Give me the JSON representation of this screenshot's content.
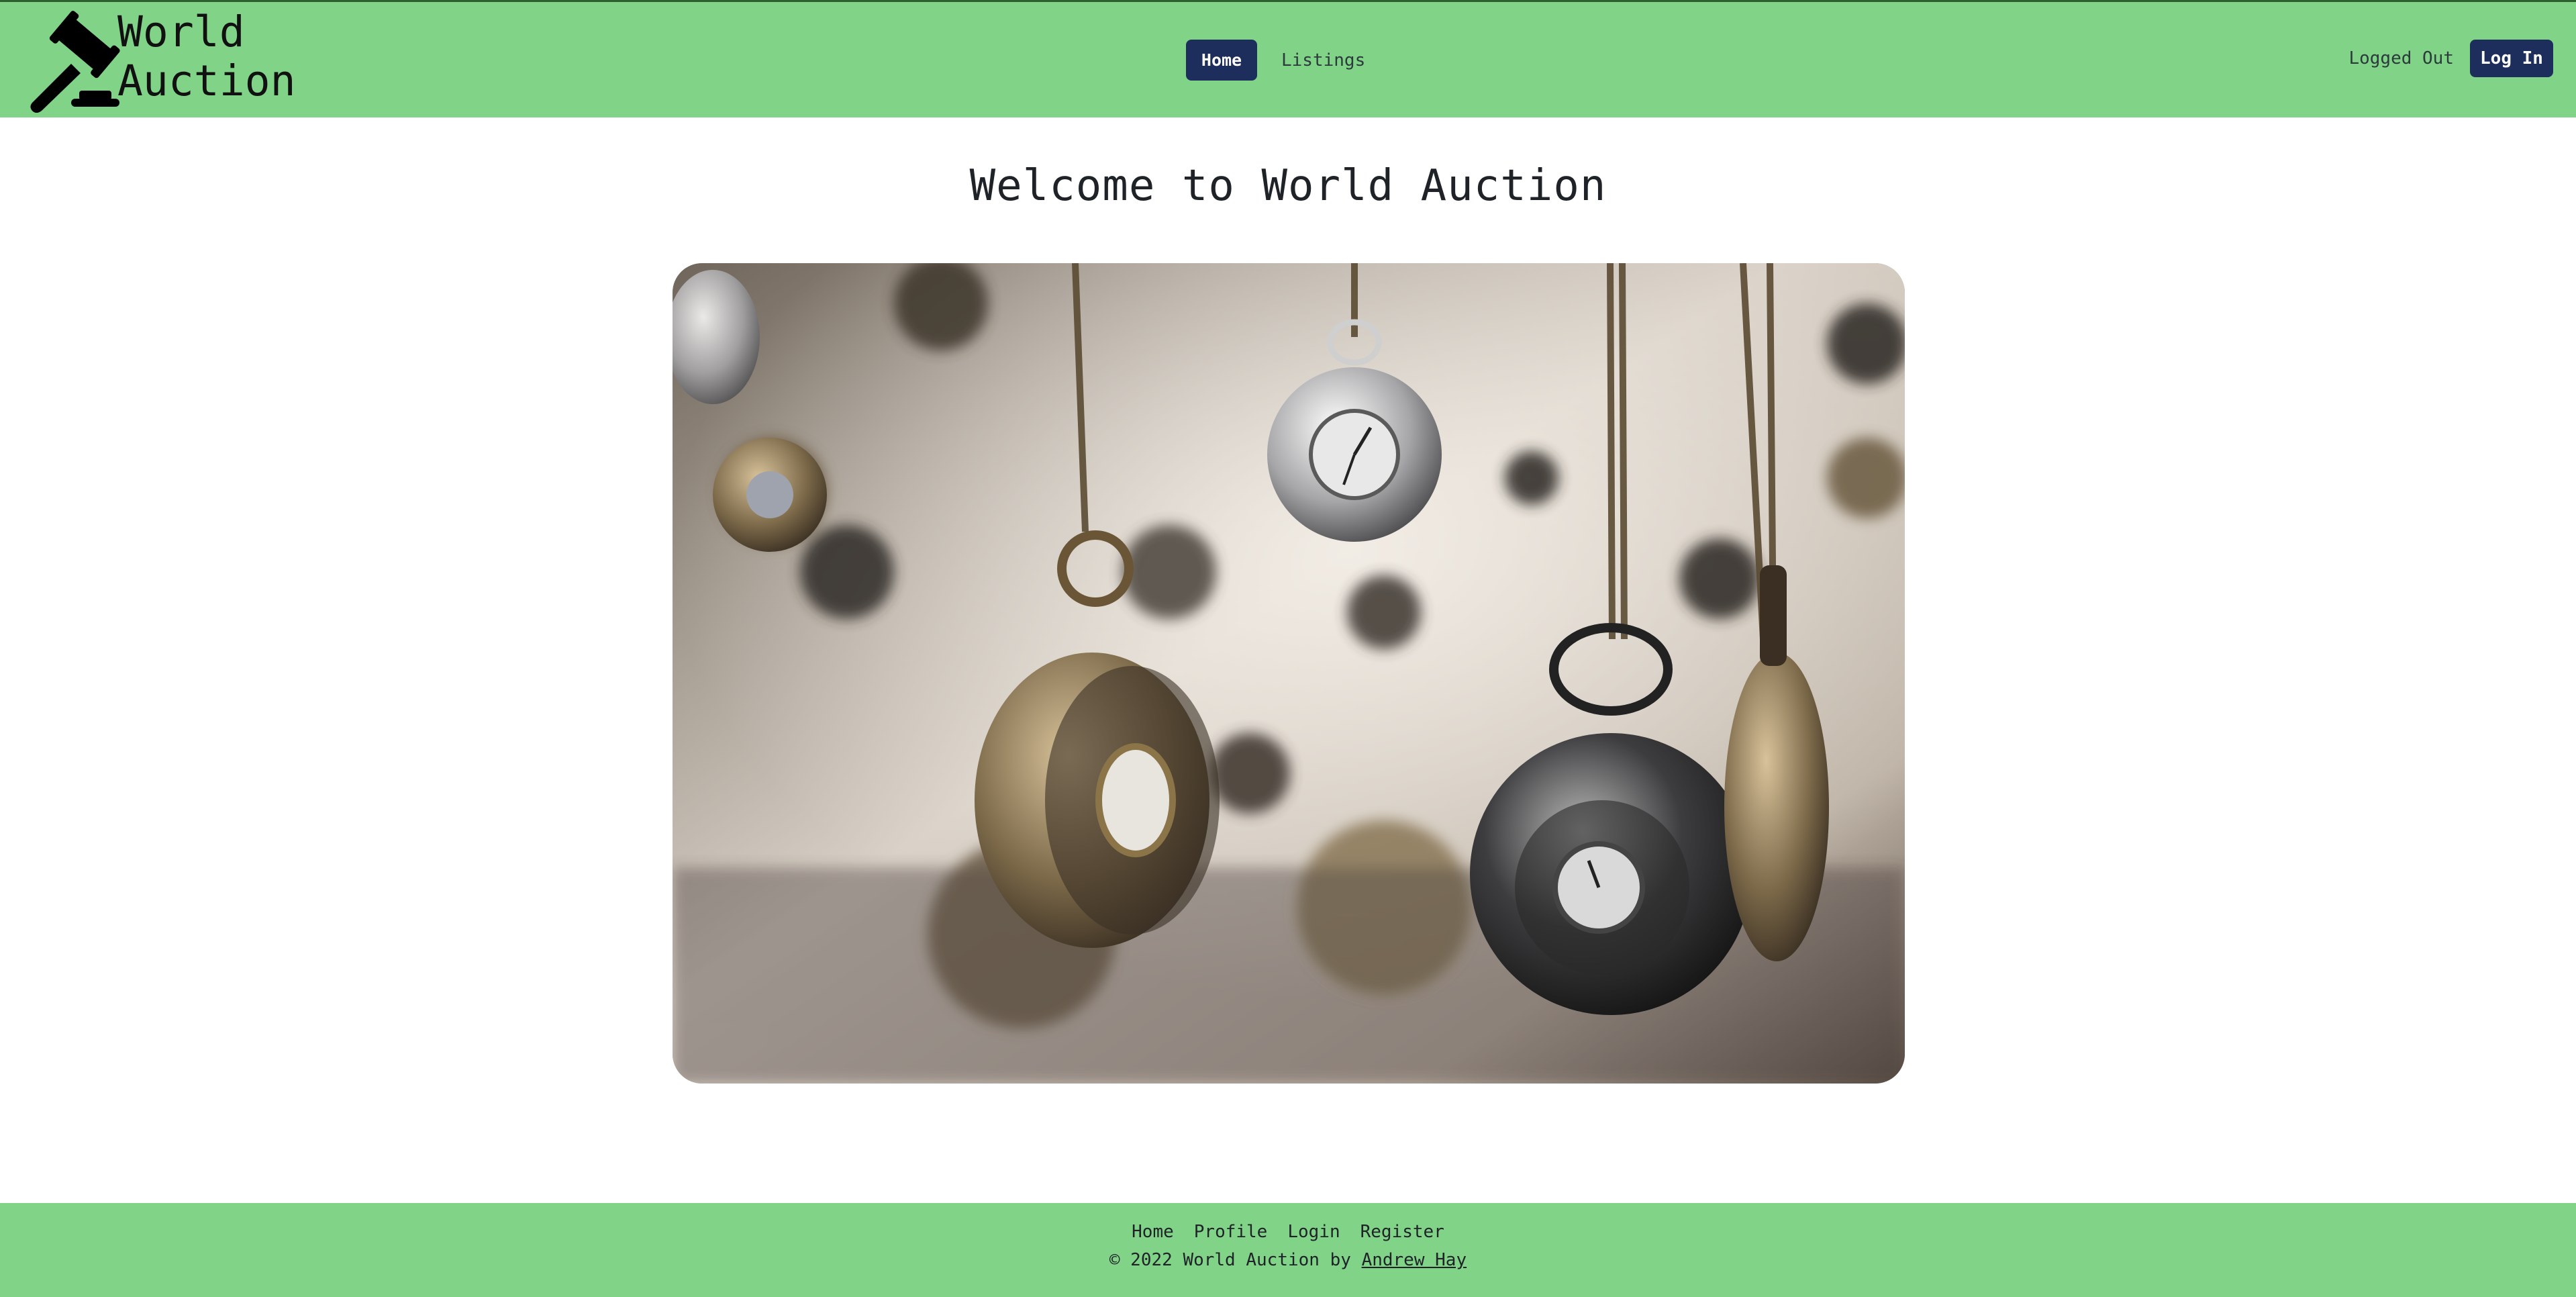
{
  "header": {
    "brand": {
      "title": "World\nAuction",
      "icon": "gavel-icon"
    },
    "nav": [
      {
        "label": "Home",
        "active": true
      },
      {
        "label": "Listings",
        "active": false
      }
    ],
    "status_text": "Logged Out",
    "login_label": "Log In"
  },
  "main": {
    "title": "Welcome to World Auction",
    "hero_image": "pocket-watches-photo"
  },
  "footer": {
    "links": [
      "Home",
      "Profile",
      "Login",
      "Register"
    ],
    "copyright_prefix": "© 2022 World Auction by ",
    "author": "Andrew Hay"
  },
  "colors": {
    "navbar_bg": "#80d387",
    "button_bg": "#1e2e5c",
    "button_text": "#ffffff",
    "page_bg": "#ffffff"
  }
}
